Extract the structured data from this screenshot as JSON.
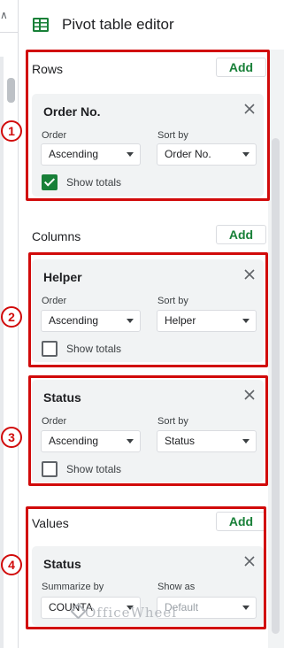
{
  "header": {
    "title": "Pivot table editor",
    "icon": "pivot-table-icon"
  },
  "colors": {
    "accent_green": "#188038",
    "annotation_red": "#d10a0a",
    "card_bg": "#f1f3f4"
  },
  "rows": {
    "label": "Rows",
    "add_label": "Add",
    "card": {
      "title": "Order No.",
      "order_label": "Order",
      "order_value": "Ascending",
      "sortby_label": "Sort by",
      "sortby_value": "Order No.",
      "show_totals_label": "Show totals",
      "show_totals_checked": true
    }
  },
  "columns": {
    "label": "Columns",
    "add_label": "Add",
    "cards": [
      {
        "title": "Helper",
        "order_label": "Order",
        "order_value": "Ascending",
        "sortby_label": "Sort by",
        "sortby_value": "Helper",
        "show_totals_label": "Show totals",
        "show_totals_checked": false
      },
      {
        "title": "Status",
        "order_label": "Order",
        "order_value": "Ascending",
        "sortby_label": "Sort by",
        "sortby_value": "Status",
        "show_totals_label": "Show totals",
        "show_totals_checked": false
      }
    ]
  },
  "values": {
    "label": "Values",
    "add_label": "Add",
    "card": {
      "title": "Status",
      "summarize_label": "Summarize by",
      "summarize_value": "COUNTA",
      "showas_label": "Show as",
      "showas_value": "Default"
    }
  },
  "markers": [
    "1",
    "2",
    "3",
    "4"
  ],
  "watermark": "OfficeWheel"
}
